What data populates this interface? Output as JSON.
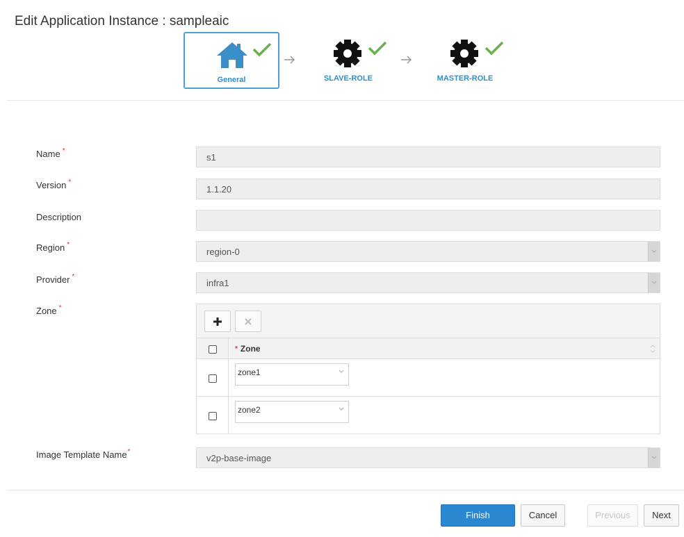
{
  "page": {
    "title": "Edit Application Instance : sampleaic"
  },
  "wizard": {
    "steps": [
      {
        "label": "General",
        "icon": "home-icon",
        "status": "complete",
        "active": true
      },
      {
        "label": "SLAVE-ROLE",
        "icon": "gear-icon",
        "status": "complete",
        "active": false
      },
      {
        "label": "MASTER-ROLE",
        "icon": "gear-icon",
        "status": "complete",
        "active": false
      }
    ]
  },
  "form": {
    "name": {
      "label": "Name",
      "value": "s1"
    },
    "version": {
      "label": "Version",
      "value": "1.1.20"
    },
    "description": {
      "label": "Description",
      "value": ""
    },
    "region": {
      "label": "Region",
      "value": "region-0"
    },
    "provider": {
      "label": "Provider",
      "value": "infra1"
    },
    "zone": {
      "label": "Zone",
      "add_icon": "plus-icon",
      "remove_icon": "x-icon",
      "column_header": "Zone",
      "rows": [
        {
          "value": "zone1"
        },
        {
          "value": "zone2"
        }
      ]
    },
    "image_template": {
      "label": "Image Template Name",
      "value": "v2p-base-image"
    },
    "required_marker": "*"
  },
  "footer": {
    "finish": "Finish",
    "cancel": "Cancel",
    "previous": "Previous",
    "next": "Next"
  },
  "colors": {
    "accent": "#2b87cf",
    "check": "#6ab04c",
    "required": "#e03030"
  }
}
